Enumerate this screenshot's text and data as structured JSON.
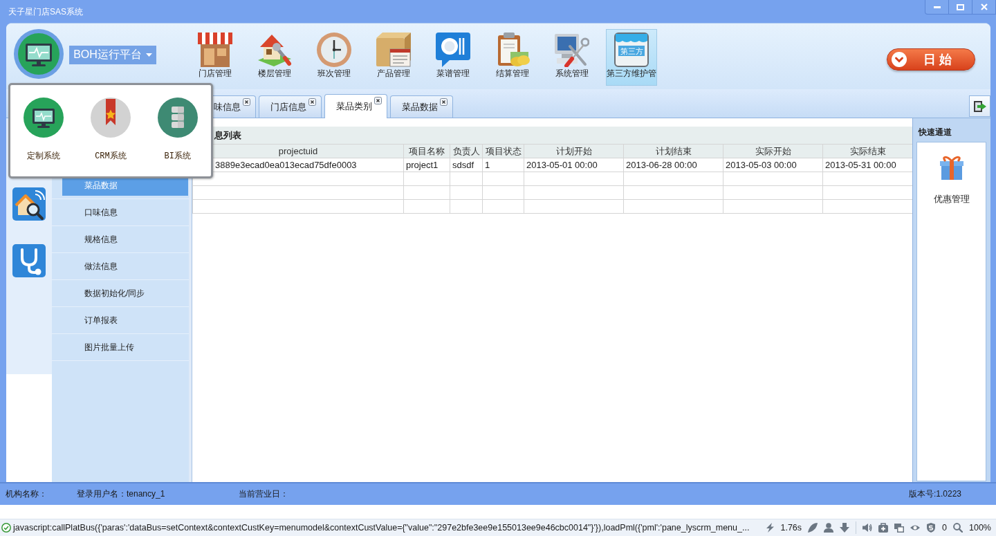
{
  "window": {
    "title": "天子星门店SAS系统"
  },
  "header": {
    "platform_menu": {
      "label": "BOH运行平台",
      "expanded": true,
      "items": [
        {
          "label": "定制系统"
        },
        {
          "label": "CRM系统"
        },
        {
          "label": "BI系统"
        }
      ]
    },
    "toolbar": [
      {
        "label": "门店管理",
        "selected": false
      },
      {
        "label": "楼层管理",
        "selected": false
      },
      {
        "label": "班次管理",
        "selected": false
      },
      {
        "label": "产品管理",
        "selected": false
      },
      {
        "label": "菜谱管理",
        "selected": false
      },
      {
        "label": "结算管理",
        "selected": false
      },
      {
        "label": "系统管理",
        "selected": false
      },
      {
        "label": "第三方维护管",
        "icon_text": "第三方",
        "selected": true
      }
    ],
    "start_button": {
      "label": "日 始"
    }
  },
  "tabs": [
    {
      "label": "味信息",
      "selected": false
    },
    {
      "label": "门店信息",
      "selected": false
    },
    {
      "label": "菜品类别",
      "selected": true
    },
    {
      "label": "菜品数据",
      "selected": false
    }
  ],
  "sidebar": {
    "items": [
      {
        "label": "菜品数据",
        "selected": true
      },
      {
        "label": "口味信息",
        "selected": false
      },
      {
        "label": "规格信息",
        "selected": false
      },
      {
        "label": "做法信息",
        "selected": false
      },
      {
        "label": "数据初始化/同步",
        "selected": false
      },
      {
        "label": "订单报表",
        "selected": false
      },
      {
        "label": "图片批量上传",
        "selected": false
      }
    ]
  },
  "content": {
    "title": "息列表",
    "table": {
      "columns": [
        "projectuid",
        "项目名称",
        "负责人",
        "项目状态",
        "计划开始",
        "计划结束",
        "实际开始",
        "实际结束"
      ],
      "rows": [
        [
          "3889e3ecad0ea013ecad75dfe0003",
          "project1",
          "sdsdf",
          "1",
          "2013-05-01 00:00",
          "2013-06-28 00:00",
          "2013-05-03 00:00",
          "2013-05-31 00:00"
        ]
      ]
    }
  },
  "quick_access": {
    "title": "快速通道",
    "items": [
      {
        "label": "优惠管理"
      }
    ]
  },
  "status_bar": {
    "org": "机构名称：",
    "user": "登录用户名：tenancy_1",
    "business_day": "当前营业日：",
    "version": "版本号:1.0223"
  },
  "browser_status": {
    "url": "javascript:callPlatBus({'paras':'dataBus=setContext&contextCustKey=menumodel&contextCustValue={\"value\":\"297e2bfe3ee9e155013ee9e46cbc0014\"}'}),loadPml({'pml':'pane_lyscrm_menu_...",
    "load_time": "1.76s",
    "blocked": "0",
    "zoom": "100%"
  }
}
